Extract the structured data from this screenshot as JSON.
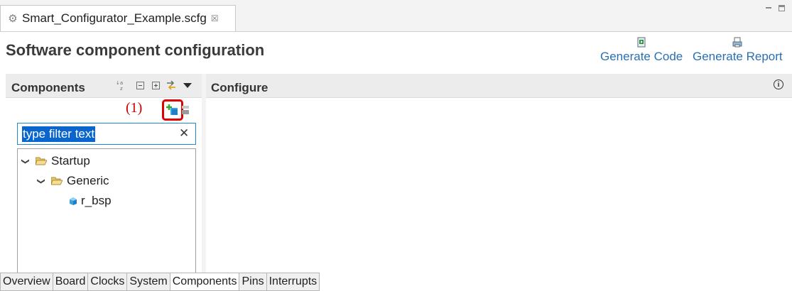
{
  "editor_tab": {
    "title": "Smart_Configurator_Example.scfg",
    "close_symbol": "☒",
    "icon": "gear-icon"
  },
  "header": {
    "title": "Software component configuration",
    "actions": [
      {
        "label": "Generate Code",
        "icon": "generate-code-icon"
      },
      {
        "label": "Generate Report",
        "icon": "generate-report-icon"
      }
    ]
  },
  "components_panel": {
    "title": "Components",
    "toolbar_icons": [
      "sort-icon",
      "collapse-all-icon",
      "expand-all-icon",
      "link-icon",
      "view-menu-icon"
    ],
    "annotation": "(1)",
    "add_button_icon": "add-component-icon",
    "filter": {
      "value": "type filter text",
      "clear_symbol": "✕"
    },
    "tree": [
      {
        "label": "Startup",
        "type": "folder",
        "expanded": true
      },
      {
        "label": "Generic",
        "type": "folder",
        "expanded": true
      },
      {
        "label": "r_bsp",
        "type": "component"
      }
    ]
  },
  "configure_panel": {
    "title": "Configure",
    "info_symbol": "i"
  },
  "bottom_tabs": [
    {
      "label": "Overview"
    },
    {
      "label": "Board"
    },
    {
      "label": "Clocks"
    },
    {
      "label": "System"
    },
    {
      "label": "Components",
      "active": true
    },
    {
      "label": "Pins"
    },
    {
      "label": "Interrupts"
    }
  ],
  "colors": {
    "link": "#2a6fb4",
    "selection": "#0a66cc",
    "annotation": "#cc0000",
    "panel_header": "#ececec"
  }
}
